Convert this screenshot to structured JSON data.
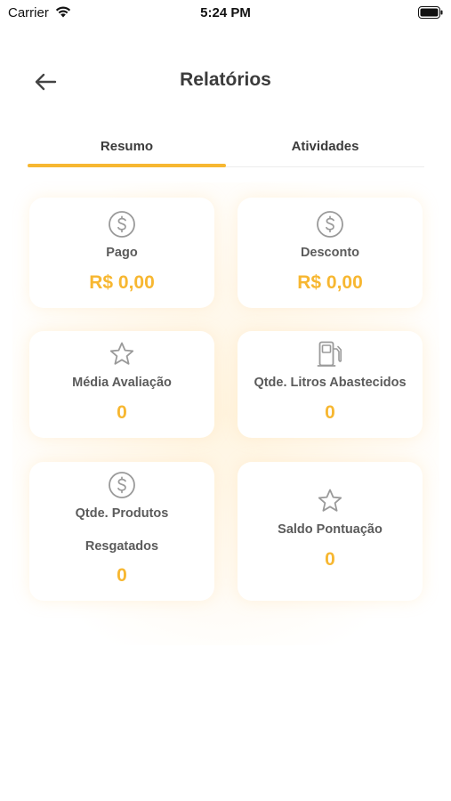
{
  "status_bar": {
    "carrier": "Carrier",
    "time": "5:24 PM"
  },
  "header": {
    "title": "Relatórios"
  },
  "tabs": [
    {
      "label": "Resumo",
      "active": true
    },
    {
      "label": "Atividades",
      "active": false
    }
  ],
  "cards": [
    {
      "icon": "dollar-circle-icon",
      "label": "Pago",
      "value": "R$ 0,00"
    },
    {
      "icon": "dollar-circle-icon",
      "label": "Desconto",
      "value": "R$ 0,00"
    },
    {
      "icon": "star-icon",
      "label": "Média Avaliação",
      "value": "0"
    },
    {
      "icon": "fuel-pump-icon",
      "label": "Qtde. Litros Abastecidos",
      "value": "0"
    },
    {
      "icon": "dollar-circle-icon",
      "label_line1": "Qtde. Produtos",
      "label_line2": "Resgatados",
      "value": "0"
    },
    {
      "icon": "star-icon",
      "label": "Saldo Pontuação",
      "value": "0"
    }
  ],
  "colors": {
    "accent": "#f7b731",
    "text": "#3b3b3b",
    "icon": "#9a9a9a"
  }
}
